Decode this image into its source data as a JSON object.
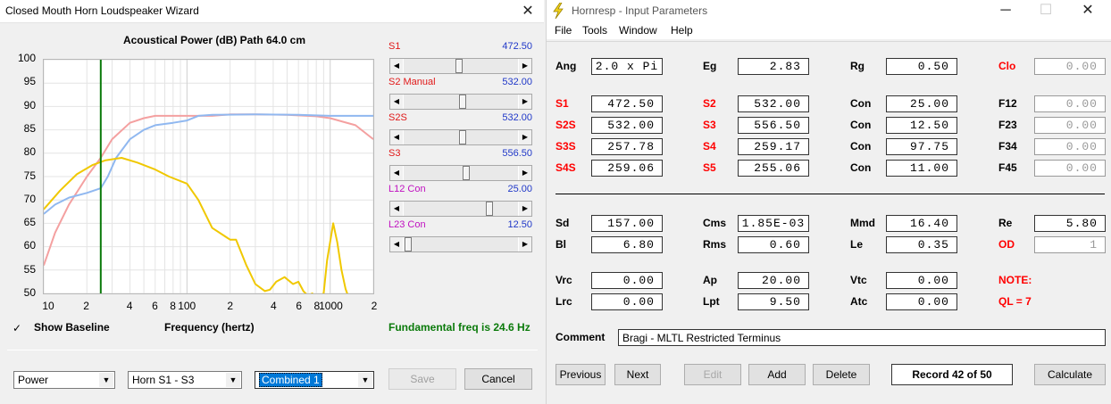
{
  "wizard": {
    "title": "Closed Mouth Horn Loudspeaker Wizard",
    "close_glyph": "✕",
    "plot_title": "Acoustical Power (dB)   Path 64.0 cm",
    "y_ticks": [
      "100",
      "95",
      "90",
      "85",
      "80",
      "75",
      "70",
      "65",
      "60",
      "55",
      "50"
    ],
    "x_ticks": [
      "10",
      "2",
      "4",
      "6",
      "8",
      "100",
      "2",
      "4",
      "6",
      "8",
      "1000",
      "2"
    ],
    "x_axis_label": "Frequency (hertz)",
    "show_baseline_label": "Show Baseline",
    "show_baseline_checked": "✓",
    "fundamental": "Fundamental freq is 24.6 Hz",
    "sliders": [
      {
        "label": "S1",
        "value": "472.50",
        "pos": 0.48
      },
      {
        "label": "S2  Manual",
        "value": "532.00",
        "pos": 0.52
      },
      {
        "label": "S2S",
        "value": "532.00",
        "pos": 0.52
      },
      {
        "label": "S3",
        "value": "556.50",
        "pos": 0.55
      },
      {
        "label": "L12  Con",
        "value": "25.00",
        "pos": 0.76
      },
      {
        "label": "L23  Con",
        "value": "12.50",
        "pos": 0.02
      }
    ],
    "combo_power": "Power",
    "combo_horn": "Horn S1 - S3",
    "combo_combined": "Combined 1",
    "save_button": "Save",
    "cancel_button": "Cancel"
  },
  "chart_data": {
    "type": "line",
    "title": "Acoustical Power (dB)   Path 64.0 cm",
    "xlabel": "Frequency (hertz)",
    "ylabel": "",
    "x_scale": "log",
    "xlim": [
      10,
      2000
    ],
    "ylim": [
      50,
      100
    ],
    "grid": true,
    "marker_x": 25,
    "series": [
      {
        "color": "#f4a0a0",
        "points": [
          [
            10,
            56
          ],
          [
            12,
            63
          ],
          [
            15,
            69
          ],
          [
            20,
            75
          ],
          [
            25,
            79
          ],
          [
            30,
            83
          ],
          [
            40,
            86.5
          ],
          [
            50,
            87.5
          ],
          [
            60,
            88
          ],
          [
            80,
            88
          ],
          [
            100,
            88
          ],
          [
            150,
            88
          ],
          [
            200,
            88.3
          ],
          [
            300,
            88.3
          ],
          [
            500,
            88.2
          ],
          [
            800,
            87.9
          ],
          [
            1000,
            87.5
          ],
          [
            1500,
            86
          ],
          [
            2000,
            83
          ]
        ]
      },
      {
        "color": "#90b8f0",
        "points": [
          [
            10,
            67
          ],
          [
            12,
            69
          ],
          [
            15,
            70.5
          ],
          [
            20,
            71.5
          ],
          [
            25,
            72.5
          ],
          [
            28,
            75
          ],
          [
            32,
            79
          ],
          [
            40,
            83
          ],
          [
            50,
            85
          ],
          [
            60,
            86
          ],
          [
            80,
            86.5
          ],
          [
            100,
            87
          ],
          [
            120,
            88
          ],
          [
            150,
            88.2
          ],
          [
            300,
            88.3
          ],
          [
            600,
            88.2
          ],
          [
            1000,
            88
          ],
          [
            1500,
            88
          ],
          [
            2000,
            88
          ]
        ]
      },
      {
        "color": "#f0c800",
        "points": [
          [
            10,
            68
          ],
          [
            13,
            72
          ],
          [
            17,
            75.5
          ],
          [
            22,
            77.5
          ],
          [
            27,
            78.5
          ],
          [
            35,
            79
          ],
          [
            45,
            78
          ],
          [
            60,
            76.5
          ],
          [
            75,
            75
          ],
          [
            100,
            73.5
          ],
          [
            120,
            70
          ],
          [
            150,
            64
          ],
          [
            200,
            61.5
          ],
          [
            220,
            61.5
          ],
          [
            260,
            56
          ],
          [
            300,
            52
          ],
          [
            350,
            50.5
          ],
          [
            380,
            50.8
          ],
          [
            420,
            52.5
          ],
          [
            480,
            53.5
          ],
          [
            550,
            52
          ],
          [
            600,
            52.5
          ],
          [
            650,
            50.5
          ],
          [
            700,
            49.5
          ],
          [
            750,
            50
          ],
          [
            800,
            49
          ],
          [
            900,
            50
          ],
          [
            950,
            57
          ],
          [
            1050,
            65
          ],
          [
            1120,
            61
          ],
          [
            1200,
            55
          ],
          [
            1280,
            51
          ],
          [
            1350,
            48
          ]
        ]
      }
    ]
  },
  "hornresp": {
    "title": "Hornresp - Input Parameters",
    "title_icon": "lightning-icon",
    "menu": [
      "File",
      "Tools",
      "Window",
      "Help"
    ],
    "win_minimize": "─",
    "win_maximize": "☐",
    "win_close": "✕",
    "row_top": {
      "ang_label": "Ang",
      "ang": "2.0 x Pi",
      "eg_label": "Eg",
      "eg": "2.83",
      "rg_label": "Rg",
      "rg": "0.50",
      "clo_label": "Clo",
      "clo": "0.00"
    },
    "row_s": [
      {
        "l1": "S1",
        "v1": "472.50",
        "l2": "S2",
        "v2": "532.00",
        "l3": "Con",
        "v3": "25.00",
        "l4": "F12",
        "v4": "0.00"
      },
      {
        "l1": "S2S",
        "v1": "532.00",
        "l2": "S3",
        "v2": "556.50",
        "l3": "Con",
        "v3": "12.50",
        "l4": "F23",
        "v4": "0.00"
      },
      {
        "l1": "S3S",
        "v1": "257.78",
        "l2": "S4",
        "v2": "259.17",
        "l3": "Con",
        "v3": "97.75",
        "l4": "F34",
        "v4": "0.00"
      },
      {
        "l1": "S4S",
        "v1": "259.06",
        "l2": "S5",
        "v2": "255.06",
        "l3": "Con",
        "v3": "11.00",
        "l4": "F45",
        "v4": "0.00"
      }
    ],
    "row_driver1": {
      "sd_label": "Sd",
      "sd": "157.00",
      "cms_label": "Cms",
      "cms": "1.85E-03",
      "mmd_label": "Mmd",
      "mmd": "16.40",
      "re_label": "Re",
      "re": "5.80"
    },
    "row_driver2": {
      "bl_label": "Bl",
      "bl": "6.80",
      "rms_label": "Rms",
      "rms": "0.60",
      "le_label": "Le",
      "le": "0.35",
      "od_label": "OD",
      "od": "1"
    },
    "row_v1": {
      "vrc_label": "Vrc",
      "vrc": "0.00",
      "ap_label": "Ap",
      "ap": "20.00",
      "vtc_label": "Vtc",
      "vtc": "0.00",
      "note": "NOTE:"
    },
    "row_v2": {
      "lrc_label": "Lrc",
      "lrc": "0.00",
      "lpt_label": "Lpt",
      "lpt": "9.50",
      "atc_label": "Atc",
      "atc": "0.00",
      "ql": "QL = 7"
    },
    "comment_label": "Comment",
    "comment": "Bragi - MLTL Restricted Terminus",
    "buttons": {
      "previous": "Previous",
      "next": "Next",
      "edit": "Edit",
      "add": "Add",
      "delete": "Delete",
      "record": "Record 42 of 50",
      "calculate": "Calculate"
    }
  }
}
